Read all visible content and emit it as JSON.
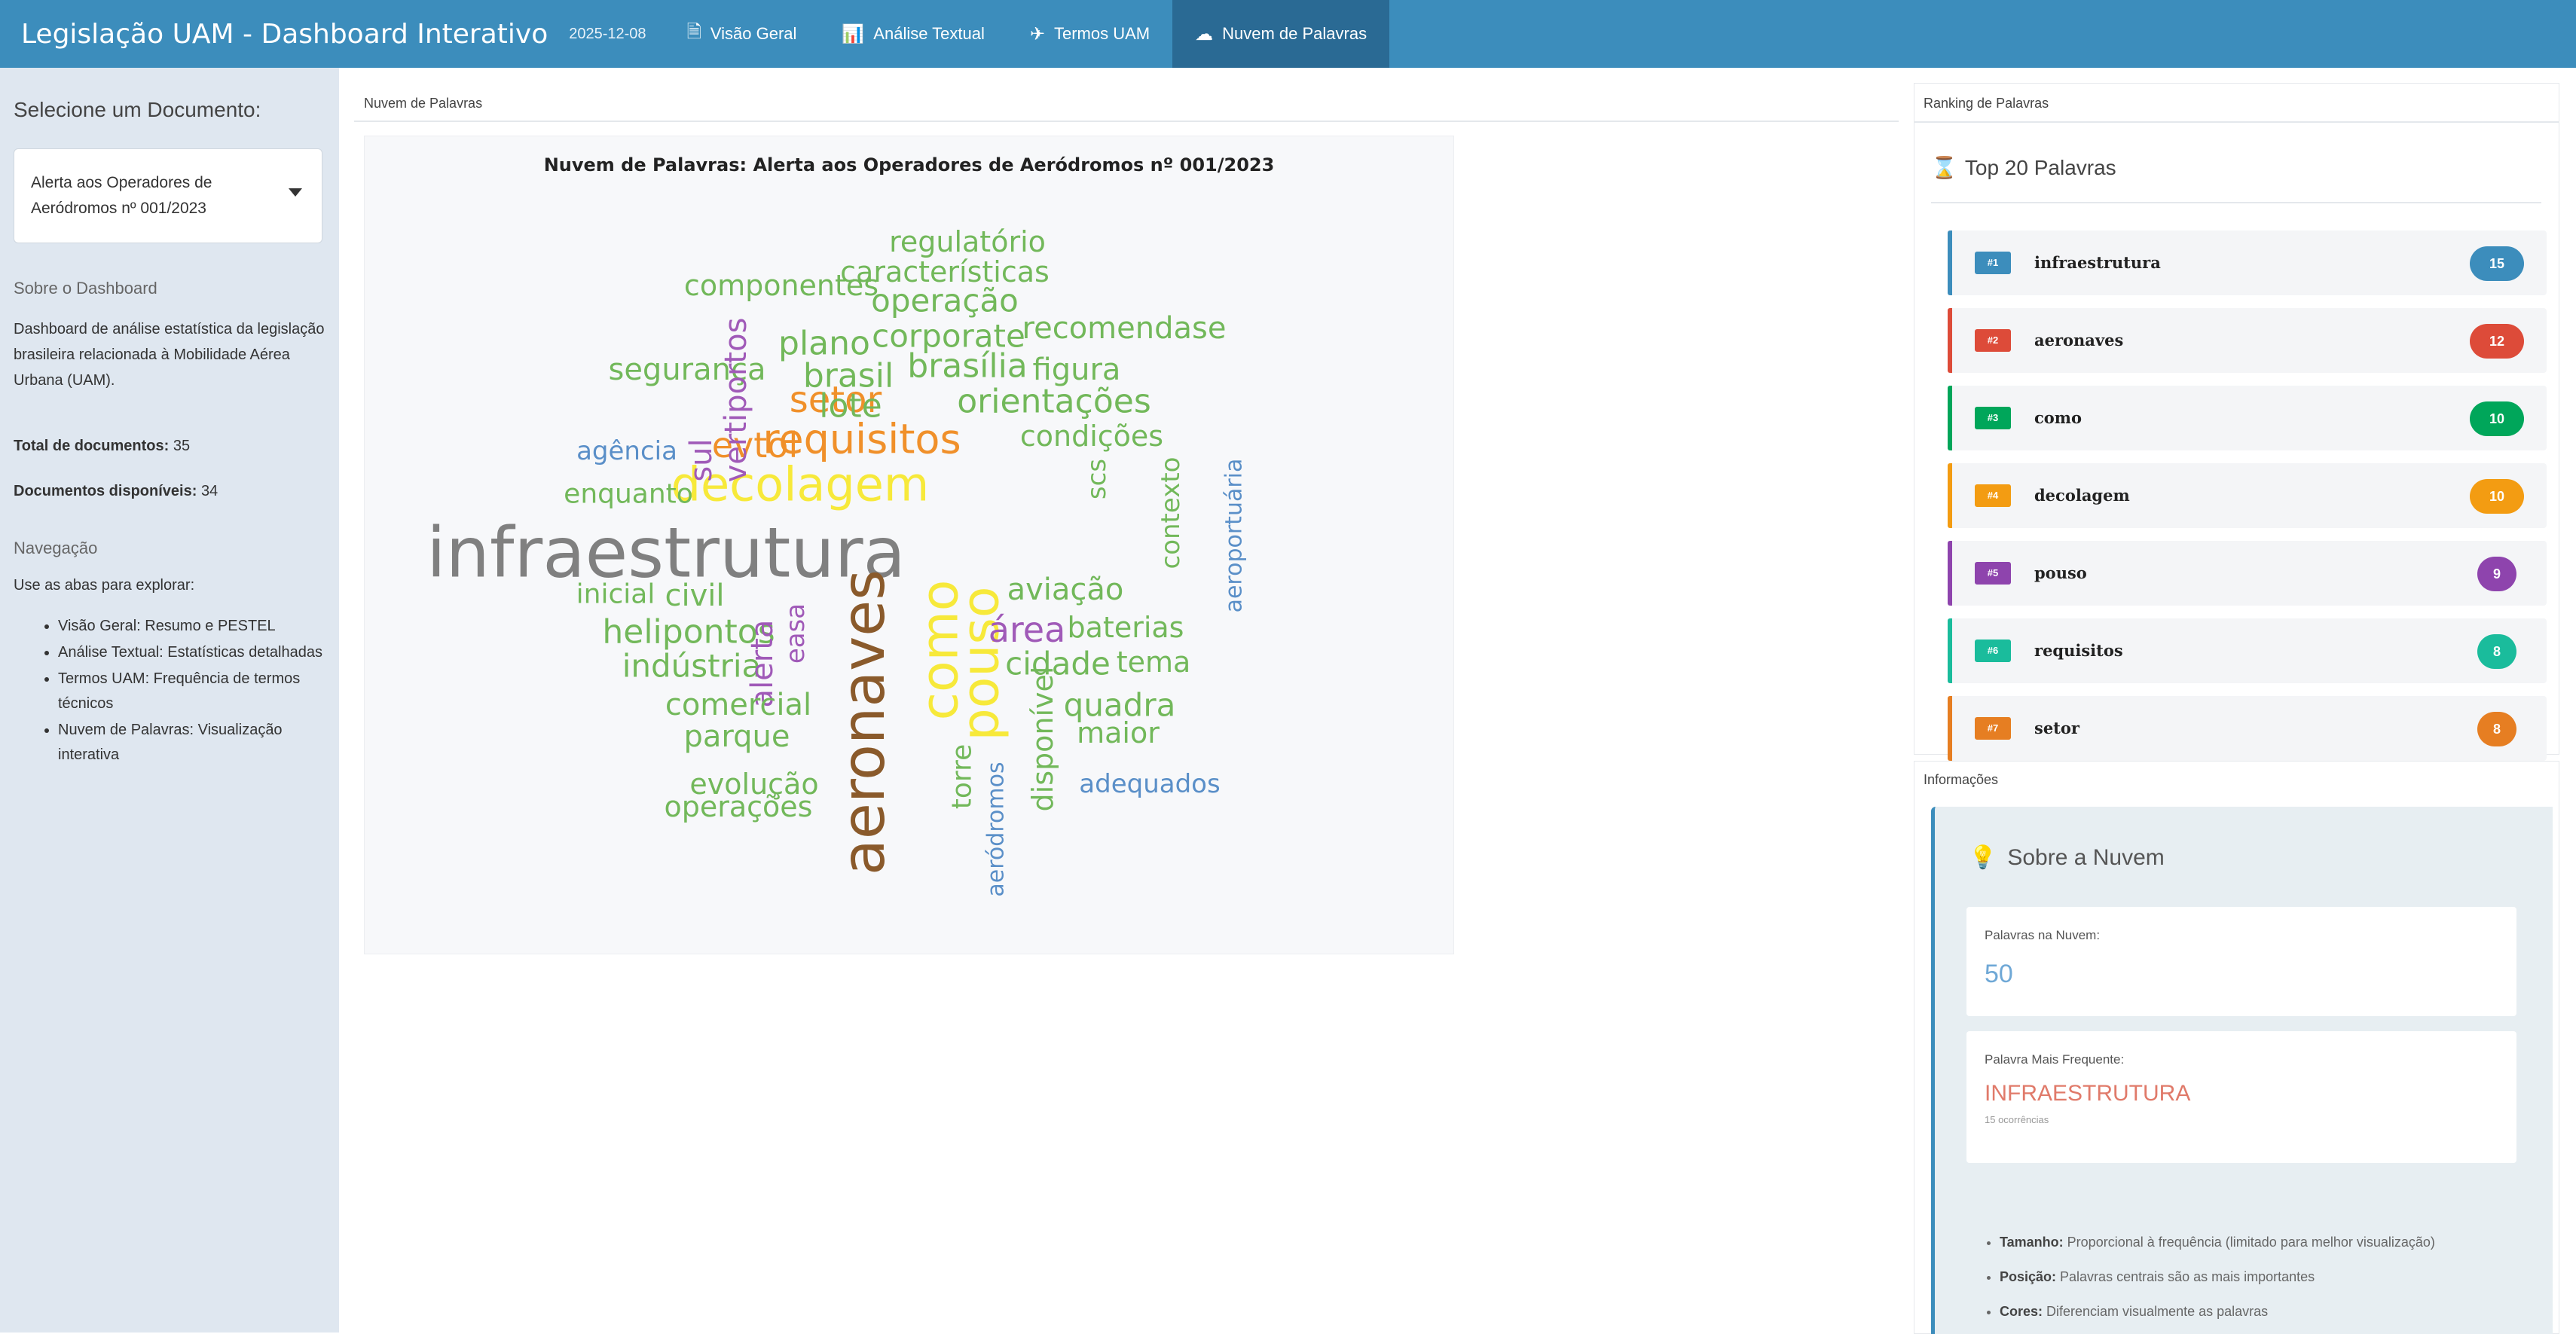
{
  "header": {
    "title": "Legislação UAM - Dashboard Interativo",
    "date": "2025-12-08",
    "tabs": [
      {
        "label": "Visão Geral",
        "icon": "document-icon"
      },
      {
        "label": "Análise Textual",
        "icon": "bar-chart-icon"
      },
      {
        "label": "Termos UAM",
        "icon": "plane-icon"
      },
      {
        "label": "Nuvem de Palavras",
        "icon": "cloud-icon",
        "active": true
      }
    ]
  },
  "sidebar": {
    "select_label": "Selecione um Documento:",
    "selected_document": "Alerta aos Operadores de Aeródromos nº 001/2023",
    "about_title": "Sobre o Dashboard",
    "about_text": "Dashboard de análise estatística da legislação brasileira relacionada à Mobilidade Aérea Urbana (UAM).",
    "total_label": "Total de documentos:",
    "total_value": "35",
    "available_label": "Documentos disponíveis:",
    "available_value": "34",
    "nav_title": "Navegação",
    "nav_intro": "Use as abas para explorar:",
    "nav_items": [
      "Visão Geral: Resumo e PESTEL",
      "Análise Textual: Estatísticas detalhadas",
      "Termos UAM: Frequência de termos técnicos",
      "Nuvem de Palavras: Visualização interativa"
    ]
  },
  "main": {
    "panel_title": "Nuvem de Palavras",
    "cloud_title": "Nuvem de Palavras: Alerta aos Operadores de Aeródromos nº 001/2023"
  },
  "cloud_words": [
    {
      "text": "infraestrutura",
      "color": "#808080"
    },
    {
      "text": "decolagem",
      "color": "#f7e93a"
    },
    {
      "text": "requisitos",
      "color": "#f0902a"
    },
    {
      "text": "setor",
      "color": "#f0902a"
    },
    {
      "text": "evtol",
      "color": "#f0902a"
    },
    {
      "text": "aeronaves",
      "color": "#8a5a2b"
    },
    {
      "text": "como",
      "color": "#f7e93a"
    },
    {
      "text": "pouso",
      "color": "#f7e93a"
    },
    {
      "text": "regulatório",
      "color": "#72b85a"
    },
    {
      "text": "características",
      "color": "#72b85a"
    },
    {
      "text": "componentes",
      "color": "#72b85a"
    },
    {
      "text": "operação",
      "color": "#72b85a"
    },
    {
      "text": "plano",
      "color": "#72b85a"
    },
    {
      "text": "corporate",
      "color": "#72b85a"
    },
    {
      "text": "recomendase",
      "color": "#72b85a"
    },
    {
      "text": "segurança",
      "color": "#72b85a"
    },
    {
      "text": "vertiportos",
      "color": "#a05ab8"
    },
    {
      "text": "brasil",
      "color": "#72b85a"
    },
    {
      "text": "brasília",
      "color": "#72b85a"
    },
    {
      "text": "figura",
      "color": "#72b85a"
    },
    {
      "text": "lote",
      "color": "#72b85a"
    },
    {
      "text": "orientações",
      "color": "#72b85a"
    },
    {
      "text": "agência",
      "color": "#5a8fc8"
    },
    {
      "text": "sul",
      "color": "#a05ab8"
    },
    {
      "text": "condições",
      "color": "#72b85a"
    },
    {
      "text": "enquanto",
      "color": "#72b85a"
    },
    {
      "text": "scs",
      "color": "#72b85a"
    },
    {
      "text": "contexto",
      "color": "#72b85a"
    },
    {
      "text": "inicial",
      "color": "#72b85a"
    },
    {
      "text": "civil",
      "color": "#72b85a"
    },
    {
      "text": "aviação",
      "color": "#72b85a"
    },
    {
      "text": "helipontos",
      "color": "#72b85a"
    },
    {
      "text": "área",
      "color": "#a05ab8"
    },
    {
      "text": "baterias",
      "color": "#72b85a"
    },
    {
      "text": "aeroportuária",
      "color": "#5a8fc8"
    },
    {
      "text": "indústria",
      "color": "#72b85a"
    },
    {
      "text": "alerta",
      "color": "#a05ab8"
    },
    {
      "text": "easa",
      "color": "#a05ab8"
    },
    {
      "text": "cidade",
      "color": "#72b85a"
    },
    {
      "text": "tema",
      "color": "#72b85a"
    },
    {
      "text": "comercial",
      "color": "#72b85a"
    },
    {
      "text": "quadra",
      "color": "#72b85a"
    },
    {
      "text": "parque",
      "color": "#72b85a"
    },
    {
      "text": "disponível",
      "color": "#72b85a"
    },
    {
      "text": "maior",
      "color": "#72b85a"
    },
    {
      "text": "evolução",
      "color": "#72b85a"
    },
    {
      "text": "torre",
      "color": "#72b85a"
    },
    {
      "text": "adequados",
      "color": "#5a8fc8"
    },
    {
      "text": "operações",
      "color": "#72b85a"
    },
    {
      "text": "aeródromos",
      "color": "#5a8fc8"
    }
  ],
  "ranking": {
    "panel_title": "Ranking de Palavras",
    "heading": "Top 20 Palavras",
    "items": [
      {
        "rank": "#1",
        "word": "infraestrutura",
        "count": "15",
        "color": "#3c8dbc"
      },
      {
        "rank": "#2",
        "word": "aeronaves",
        "count": "12",
        "color": "#dd4b39"
      },
      {
        "rank": "#3",
        "word": "como",
        "count": "10",
        "color": "#00a65a"
      },
      {
        "rank": "#4",
        "word": "decolagem",
        "count": "10",
        "color": "#f39c12"
      },
      {
        "rank": "#5",
        "word": "pouso",
        "count": "9",
        "color": "#8e44ad"
      },
      {
        "rank": "#6",
        "word": "requisitos",
        "count": "8",
        "color": "#1abc9c"
      },
      {
        "rank": "#7",
        "word": "setor",
        "count": "8",
        "color": "#e67e22"
      }
    ]
  },
  "info": {
    "panel_title": "Informações",
    "heading": "Sobre a Nuvem",
    "words_label": "Palavras na Nuvem:",
    "words_value": "50",
    "most_label": "Palavra Mais Frequente:",
    "most_value": "INFRAESTRUTURA",
    "most_sub": "15 ocorrências",
    "notes": [
      {
        "bold": "Tamanho:",
        "text": " Proporcional à frequência (limitado para melhor visualização)"
      },
      {
        "bold": "Posição:",
        "text": " Palavras centrais são as mais importantes"
      },
      {
        "bold": "Cores:",
        "text": " Diferenciam visualmente as palavras"
      }
    ]
  }
}
